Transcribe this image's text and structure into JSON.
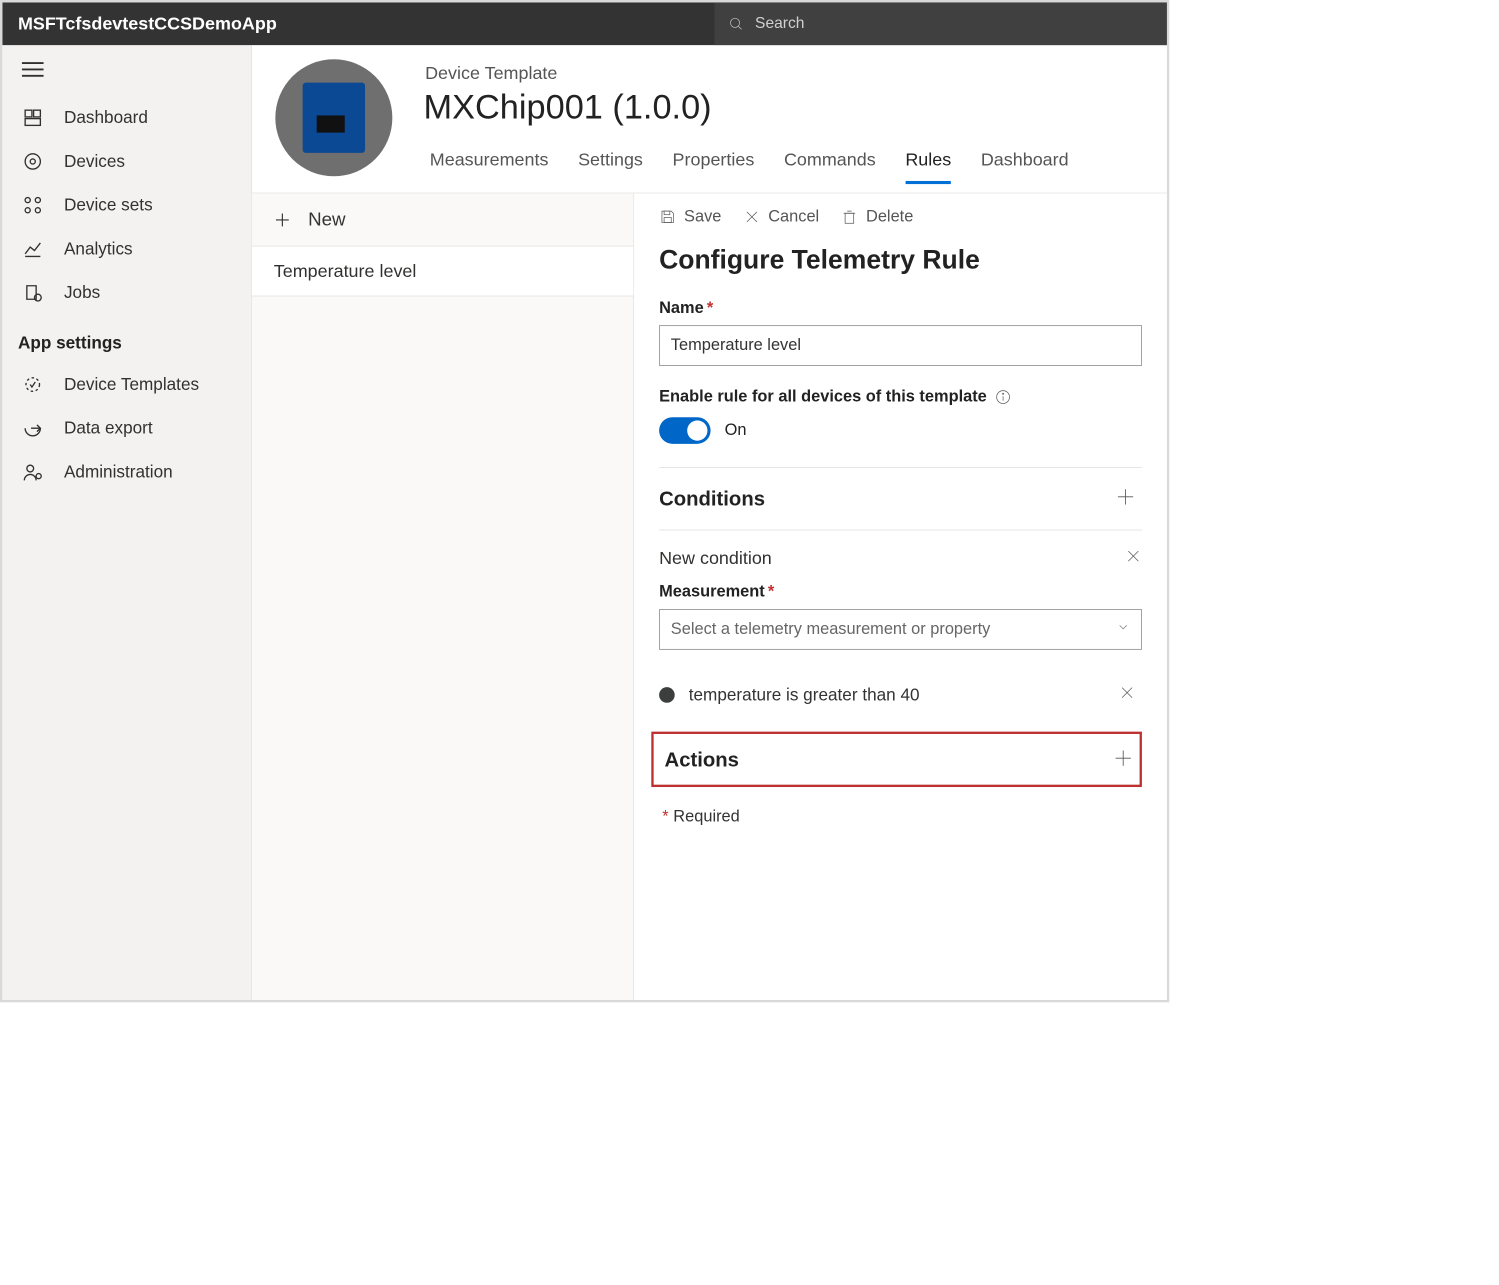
{
  "topbar": {
    "app_title": "MSFTcfsdevtestCCSDemoApp",
    "search_placeholder": "Search"
  },
  "sidebar": {
    "items": [
      {
        "label": "Dashboard"
      },
      {
        "label": "Devices"
      },
      {
        "label": "Device sets"
      },
      {
        "label": "Analytics"
      },
      {
        "label": "Jobs"
      }
    ],
    "group_label": "App settings",
    "settings_items": [
      {
        "label": "Device Templates"
      },
      {
        "label": "Data export"
      },
      {
        "label": "Administration"
      }
    ]
  },
  "header": {
    "breadcrumb": "Device Template",
    "title": "MXChip001  (1.0.0)",
    "tabs": [
      "Measurements",
      "Settings",
      "Properties",
      "Commands",
      "Rules",
      "Dashboard"
    ],
    "active_tab": "Rules"
  },
  "rules_list": {
    "new_label": "New",
    "items": [
      "Temperature level"
    ]
  },
  "cmdbar": {
    "save": "Save",
    "cancel": "Cancel",
    "delete": "Delete"
  },
  "panel": {
    "title": "Configure Telemetry Rule",
    "name_label": "Name",
    "name_value": "Temperature level",
    "enable_label": "Enable rule for all devices of this template",
    "toggle_state": "On",
    "conditions_label": "Conditions",
    "new_condition_label": "New condition",
    "measurement_label": "Measurement",
    "measurement_placeholder": "Select a telemetry measurement or property",
    "existing_condition_text": "temperature is greater than 40",
    "actions_label": "Actions",
    "required_note": "Required"
  }
}
